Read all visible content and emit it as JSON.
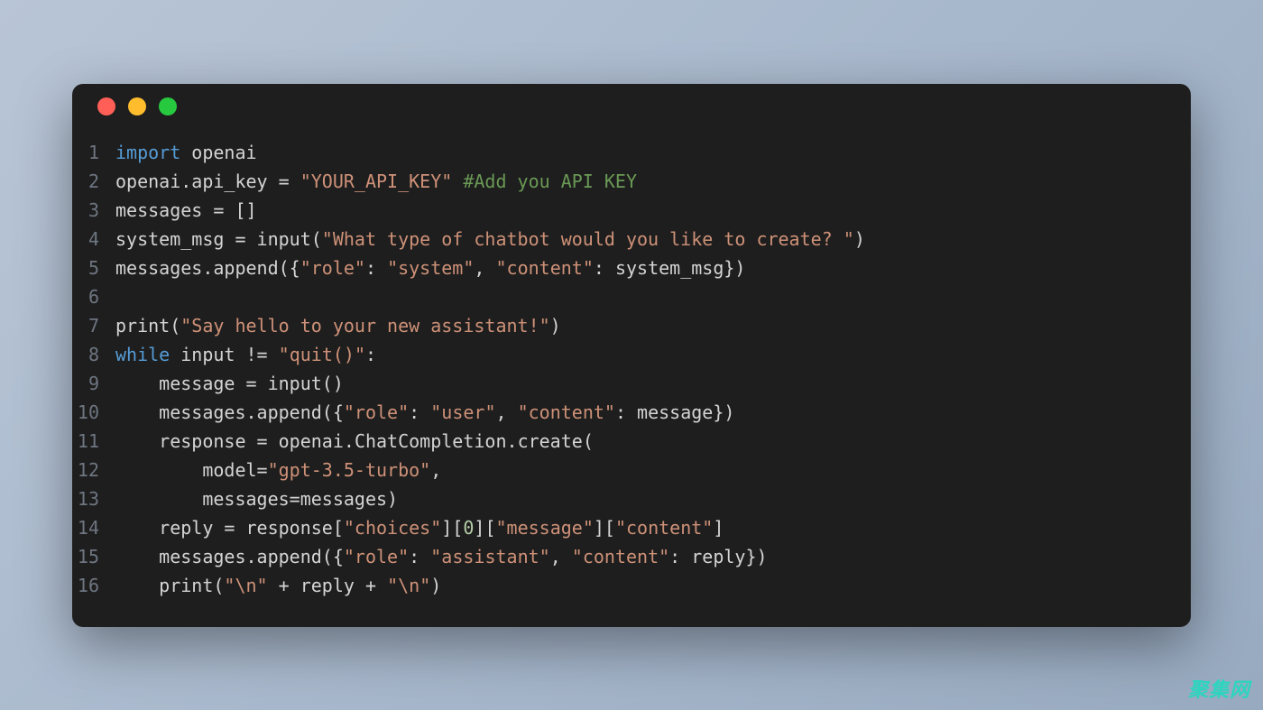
{
  "window": {
    "traffic_lights": [
      "red",
      "yellow",
      "green"
    ]
  },
  "code": {
    "lines": [
      {
        "n": "1",
        "tokens": [
          [
            "kw",
            "import"
          ],
          [
            "id",
            " openai"
          ]
        ]
      },
      {
        "n": "2",
        "tokens": [
          [
            "id",
            "openai"
          ],
          [
            "op",
            "."
          ],
          [
            "id",
            "api_key "
          ],
          [
            "op",
            "="
          ],
          [
            "id",
            " "
          ],
          [
            "str",
            "\"YOUR_API_KEY\""
          ],
          [
            "id",
            " "
          ],
          [
            "cmt",
            "#Add you API KEY"
          ]
        ]
      },
      {
        "n": "3",
        "tokens": [
          [
            "id",
            "messages "
          ],
          [
            "op",
            "="
          ],
          [
            "id",
            " "
          ],
          [
            "pn",
            "[]"
          ]
        ]
      },
      {
        "n": "4",
        "tokens": [
          [
            "id",
            "system_msg "
          ],
          [
            "op",
            "="
          ],
          [
            "id",
            " input"
          ],
          [
            "pn",
            "("
          ],
          [
            "str",
            "\"What type of chatbot would you like to create? \""
          ],
          [
            "pn",
            ")"
          ]
        ]
      },
      {
        "n": "5",
        "tokens": [
          [
            "id",
            "messages"
          ],
          [
            "op",
            "."
          ],
          [
            "id",
            "append"
          ],
          [
            "pn",
            "({"
          ],
          [
            "str",
            "\"role\""
          ],
          [
            "pn",
            ": "
          ],
          [
            "str",
            "\"system\""
          ],
          [
            "pn",
            ", "
          ],
          [
            "str",
            "\"content\""
          ],
          [
            "pn",
            ": "
          ],
          [
            "id",
            "system_msg"
          ],
          [
            "pn",
            "})"
          ]
        ]
      },
      {
        "n": "6",
        "tokens": []
      },
      {
        "n": "7",
        "tokens": [
          [
            "id",
            "print"
          ],
          [
            "pn",
            "("
          ],
          [
            "str",
            "\"Say hello to your new assistant!\""
          ],
          [
            "pn",
            ")"
          ]
        ]
      },
      {
        "n": "8",
        "tokens": [
          [
            "kw",
            "while"
          ],
          [
            "id",
            " input "
          ],
          [
            "op",
            "!="
          ],
          [
            "id",
            " "
          ],
          [
            "str",
            "\"quit()\""
          ],
          [
            "pn",
            ":"
          ]
        ]
      },
      {
        "n": "9",
        "tokens": [
          [
            "id",
            "    message "
          ],
          [
            "op",
            "="
          ],
          [
            "id",
            " input"
          ],
          [
            "pn",
            "()"
          ]
        ]
      },
      {
        "n": "10",
        "tokens": [
          [
            "id",
            "    messages"
          ],
          [
            "op",
            "."
          ],
          [
            "id",
            "append"
          ],
          [
            "pn",
            "({"
          ],
          [
            "str",
            "\"role\""
          ],
          [
            "pn",
            ": "
          ],
          [
            "str",
            "\"user\""
          ],
          [
            "pn",
            ", "
          ],
          [
            "str",
            "\"content\""
          ],
          [
            "pn",
            ": "
          ],
          [
            "id",
            "message"
          ],
          [
            "pn",
            "})"
          ]
        ]
      },
      {
        "n": "11",
        "tokens": [
          [
            "id",
            "    response "
          ],
          [
            "op",
            "="
          ],
          [
            "id",
            " openai"
          ],
          [
            "op",
            "."
          ],
          [
            "id",
            "ChatCompletion"
          ],
          [
            "op",
            "."
          ],
          [
            "id",
            "create"
          ],
          [
            "pn",
            "("
          ]
        ]
      },
      {
        "n": "12",
        "tokens": [
          [
            "id",
            "        model"
          ],
          [
            "op",
            "="
          ],
          [
            "str",
            "\"gpt-3.5-turbo\""
          ],
          [
            "pn",
            ","
          ]
        ]
      },
      {
        "n": "13",
        "tokens": [
          [
            "id",
            "        messages"
          ],
          [
            "op",
            "="
          ],
          [
            "id",
            "messages"
          ],
          [
            "pn",
            ")"
          ]
        ]
      },
      {
        "n": "14",
        "tokens": [
          [
            "id",
            "    reply "
          ],
          [
            "op",
            "="
          ],
          [
            "id",
            " response"
          ],
          [
            "pn",
            "["
          ],
          [
            "str",
            "\"choices\""
          ],
          [
            "pn",
            "]["
          ],
          [
            "num",
            "0"
          ],
          [
            "pn",
            "]["
          ],
          [
            "str",
            "\"message\""
          ],
          [
            "pn",
            "]["
          ],
          [
            "str",
            "\"content\""
          ],
          [
            "pn",
            "]"
          ]
        ]
      },
      {
        "n": "15",
        "tokens": [
          [
            "id",
            "    messages"
          ],
          [
            "op",
            "."
          ],
          [
            "id",
            "append"
          ],
          [
            "pn",
            "({"
          ],
          [
            "str",
            "\"role\""
          ],
          [
            "pn",
            ": "
          ],
          [
            "str",
            "\"assistant\""
          ],
          [
            "pn",
            ", "
          ],
          [
            "str",
            "\"content\""
          ],
          [
            "pn",
            ": "
          ],
          [
            "id",
            "reply"
          ],
          [
            "pn",
            "})"
          ]
        ]
      },
      {
        "n": "16",
        "tokens": [
          [
            "id",
            "    print"
          ],
          [
            "pn",
            "("
          ],
          [
            "str",
            "\"\\n\""
          ],
          [
            "id",
            " "
          ],
          [
            "op",
            "+"
          ],
          [
            "id",
            " reply "
          ],
          [
            "op",
            "+"
          ],
          [
            "id",
            " "
          ],
          [
            "str",
            "\"\\n\""
          ],
          [
            "pn",
            ")"
          ]
        ]
      }
    ]
  },
  "watermark": "聚集网"
}
